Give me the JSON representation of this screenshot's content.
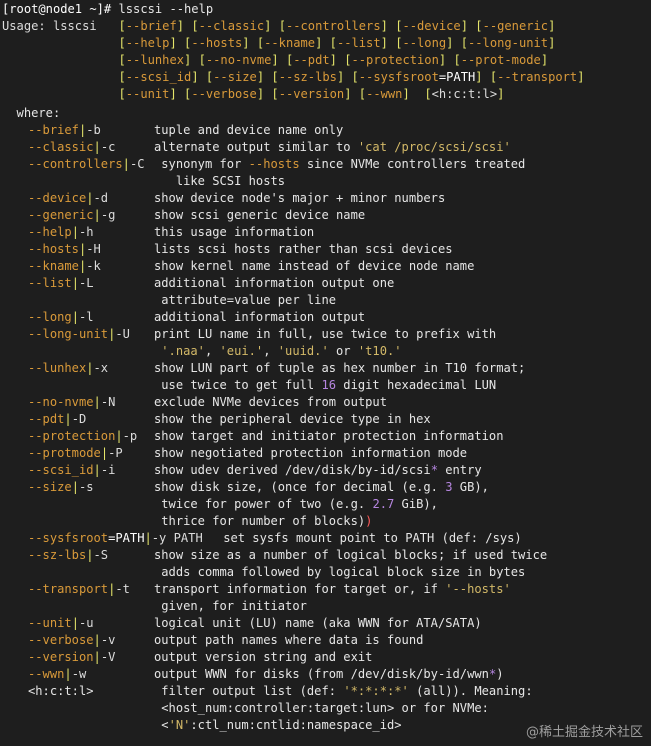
{
  "prompt": {
    "user_host": "[root@node1 ~]#",
    "command": " lsscsi --help"
  },
  "usage": [
    "Usage: lsscsi   [--brief] [--classic] [--controllers] [--device] [--generic]",
    "                [--help] [--hosts] [--kname] [--list] [--long] [--long-unit]",
    "                [--lunhex] [--no-nvme] [--pdt] [--protection] [--prot-mode]",
    "                [--scsi_id] [--size] [--sz-lbs] [--sysfsroot=PATH] [--transport]",
    "                [--unit] [--verbose] [--version] [--wwn]  [<h:c:t:l>]"
  ],
  "where_label": "  where:",
  "options": [
    {
      "opt": "--brief|-b",
      "desc": "tuple and device name only"
    },
    {
      "opt": "--classic|-c",
      "desc": "alternate output similar to 'cat /proc/scsi/scsi'"
    },
    {
      "opt": "--controllers|-C",
      "desc": " synonym for --hosts since NVMe controllers treated"
    },
    {
      "opt": "",
      "desc": "   like SCSI hosts"
    },
    {
      "opt": "--device|-d",
      "desc": "show device node's major + minor numbers"
    },
    {
      "opt": "--generic|-g",
      "desc": "show scsi generic device name"
    },
    {
      "opt": "--help|-h",
      "desc": "this usage information"
    },
    {
      "opt": "--hosts|-H",
      "desc": "lists scsi hosts rather than scsi devices"
    },
    {
      "opt": "--kname|-k",
      "desc": "show kernel name instead of device node name"
    },
    {
      "opt": "--list|-L",
      "desc": "additional information output one"
    },
    {
      "opt": "",
      "desc": " attribute=value per line"
    },
    {
      "opt": "--long|-l",
      "desc": "additional information output"
    },
    {
      "opt": "--long-unit|-U",
      "desc": "print LU name in full, use twice to prefix with"
    },
    {
      "opt": "",
      "desc": " '.naa', 'eui.', 'uuid.' or 't10.'"
    },
    {
      "opt": "--lunhex|-x",
      "desc": "show LUN part of tuple as hex number in T10 format;"
    },
    {
      "opt": "",
      "desc": " use twice to get full 16 digit hexadecimal LUN"
    },
    {
      "opt": "--no-nvme|-N",
      "desc": "exclude NVMe devices from output"
    },
    {
      "opt": "--pdt|-D",
      "desc": "show the peripheral device type in hex"
    },
    {
      "opt": "--protection|-p",
      "desc": "show target and initiator protection information"
    },
    {
      "opt": "--protmode|-P",
      "desc": "show negotiated protection information mode"
    },
    {
      "opt": "--scsi_id|-i",
      "desc": "show udev derived /dev/disk/by-id/scsi* entry"
    },
    {
      "opt": "--size|-s",
      "desc": "show disk size, (once for decimal (e.g. 3 GB),"
    },
    {
      "opt": "",
      "desc": " twice for power of two (e.g. 2.7 GiB),"
    },
    {
      "opt": "",
      "desc": " thrice for number of blocks))"
    },
    {
      "opt": "--sysfsroot=PATH|-y PATH",
      "desc": "set sysfs mount point to PATH (def: /sys)"
    },
    {
      "opt": "--sz-lbs|-S",
      "desc": "show size as a number of logical blocks; if used twice"
    },
    {
      "opt": "",
      "desc": " adds comma followed by logical block size in bytes"
    },
    {
      "opt": "--transport|-t",
      "desc": "transport information for target or, if '--hosts'"
    },
    {
      "opt": "",
      "desc": " given, for initiator"
    },
    {
      "opt": "--unit|-u",
      "desc": "logical unit (LU) name (aka WWN for ATA/SATA)"
    },
    {
      "opt": "--verbose|-v",
      "desc": "output path names where data is found"
    },
    {
      "opt": "--version|-V",
      "desc": "output version string and exit"
    },
    {
      "opt": "--wwn|-w",
      "desc": "output WWN for disks (from /dev/disk/by-id/wwn*)"
    },
    {
      "opt": "<h:c:t:l>",
      "desc": " filter output list (def: '*:*:*:*' (all)). Meaning:"
    },
    {
      "opt": "",
      "desc": " <host_num:controller:target:lun> or for NVMe:"
    },
    {
      "opt": "",
      "desc": " <'N':ctl_num:cntlid:namespace_id>"
    }
  ],
  "watermark": "@稀土掘金技术社区"
}
